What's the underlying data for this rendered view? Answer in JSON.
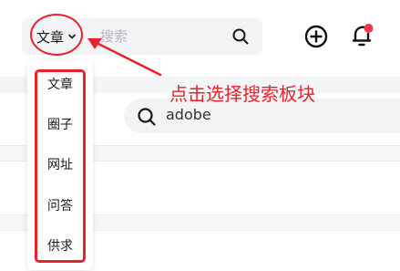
{
  "header": {
    "search_scope": "文章",
    "search_placeholder": "搜索",
    "icons": {
      "scope_chevron": "chevron-down-icon",
      "search": "search-icon",
      "add": "plus-circle-icon",
      "notifications": "bell-icon"
    },
    "notification_dot_color": "#f0384a"
  },
  "dropdown": {
    "items": [
      "文章",
      "圈子",
      "网址",
      "问答",
      "供求"
    ]
  },
  "annotation": {
    "text": "点击选择搜索板块",
    "color": "#e8222d"
  },
  "secondary_search": {
    "value": "adobe"
  }
}
